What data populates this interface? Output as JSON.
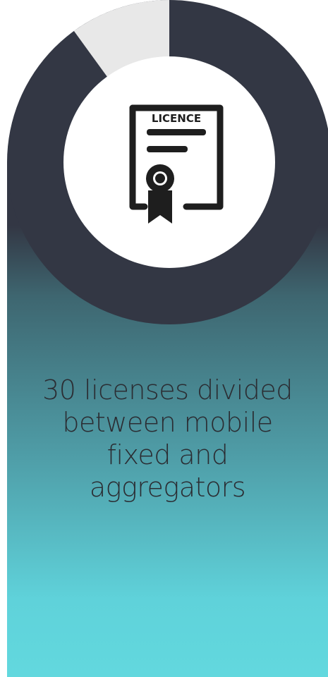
{
  "colors": {
    "donut_main": "#333744",
    "donut_remainder": "#e8e8e8",
    "center": "#ffffff",
    "gradient_top": "#333744",
    "gradient_bottom": "#62d8de",
    "caption_text": "#2b2d33",
    "icon": "#1e1e1e"
  },
  "donut": {
    "filled_fraction": 0.9,
    "remainder_fraction": 0.1
  },
  "icon": {
    "name": "licence-certificate-icon",
    "label": "LICENCE"
  },
  "caption": {
    "lines": [
      "30 licenses divided",
      "between mobile",
      "fixed and",
      "aggregators"
    ]
  }
}
